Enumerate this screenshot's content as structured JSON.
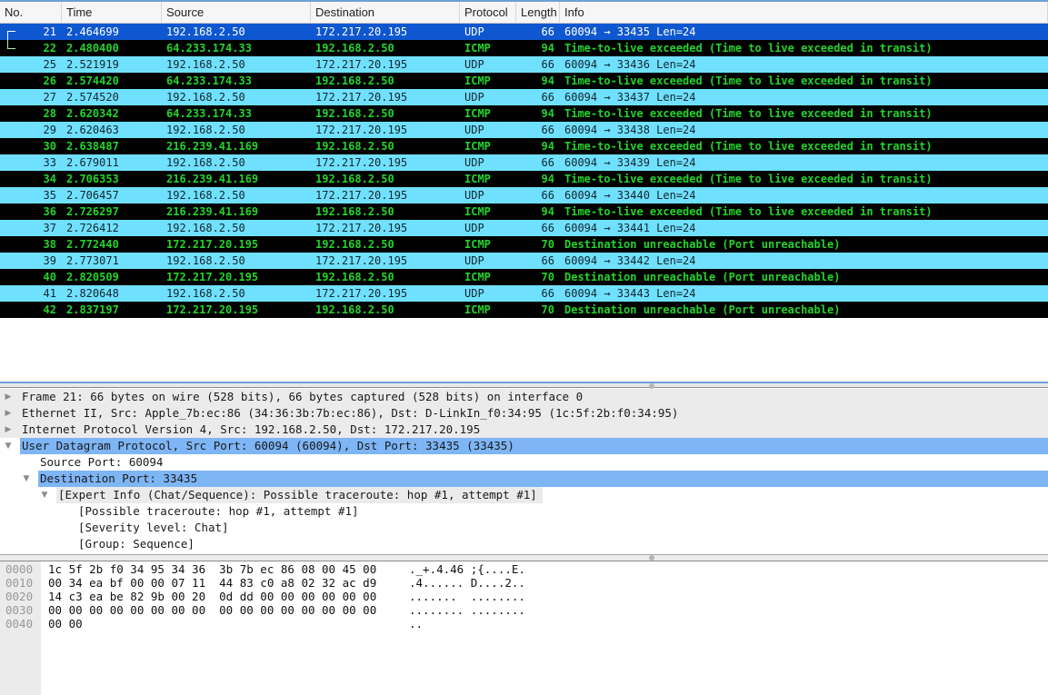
{
  "packet_list": {
    "columns": [
      "No.",
      "Time",
      "Source",
      "Destination",
      "Protocol",
      "Length",
      "Info"
    ],
    "rows": [
      {
        "no": "21",
        "time": "2.464699",
        "src": "192.168.2.50",
        "dst": "172.217.20.195",
        "proto": "UDP",
        "len": "66",
        "info": "60094 → 33435  Len=24",
        "type": "sel"
      },
      {
        "no": "22",
        "time": "2.480400",
        "src": "64.233.174.33",
        "dst": "192.168.2.50",
        "proto": "ICMP",
        "len": "94",
        "info": "Time-to-live exceeded (Time to live exceeded in transit)",
        "type": "icmp"
      },
      {
        "no": "25",
        "time": "2.521919",
        "src": "192.168.2.50",
        "dst": "172.217.20.195",
        "proto": "UDP",
        "len": "66",
        "info": "60094 → 33436  Len=24",
        "type": "udp"
      },
      {
        "no": "26",
        "time": "2.574420",
        "src": "64.233.174.33",
        "dst": "192.168.2.50",
        "proto": "ICMP",
        "len": "94",
        "info": "Time-to-live exceeded (Time to live exceeded in transit)",
        "type": "icmp"
      },
      {
        "no": "27",
        "time": "2.574520",
        "src": "192.168.2.50",
        "dst": "172.217.20.195",
        "proto": "UDP",
        "len": "66",
        "info": "60094 → 33437  Len=24",
        "type": "udp"
      },
      {
        "no": "28",
        "time": "2.620342",
        "src": "64.233.174.33",
        "dst": "192.168.2.50",
        "proto": "ICMP",
        "len": "94",
        "info": "Time-to-live exceeded (Time to live exceeded in transit)",
        "type": "icmp"
      },
      {
        "no": "29",
        "time": "2.620463",
        "src": "192.168.2.50",
        "dst": "172.217.20.195",
        "proto": "UDP",
        "len": "66",
        "info": "60094 → 33438  Len=24",
        "type": "udp"
      },
      {
        "no": "30",
        "time": "2.638487",
        "src": "216.239.41.169",
        "dst": "192.168.2.50",
        "proto": "ICMP",
        "len": "94",
        "info": "Time-to-live exceeded (Time to live exceeded in transit)",
        "type": "icmp"
      },
      {
        "no": "33",
        "time": "2.679011",
        "src": "192.168.2.50",
        "dst": "172.217.20.195",
        "proto": "UDP",
        "len": "66",
        "info": "60094 → 33439  Len=24",
        "type": "udp"
      },
      {
        "no": "34",
        "time": "2.706353",
        "src": "216.239.41.169",
        "dst": "192.168.2.50",
        "proto": "ICMP",
        "len": "94",
        "info": "Time-to-live exceeded (Time to live exceeded in transit)",
        "type": "icmp"
      },
      {
        "no": "35",
        "time": "2.706457",
        "src": "192.168.2.50",
        "dst": "172.217.20.195",
        "proto": "UDP",
        "len": "66",
        "info": "60094 → 33440  Len=24",
        "type": "udp"
      },
      {
        "no": "36",
        "time": "2.726297",
        "src": "216.239.41.169",
        "dst": "192.168.2.50",
        "proto": "ICMP",
        "len": "94",
        "info": "Time-to-live exceeded (Time to live exceeded in transit)",
        "type": "icmp"
      },
      {
        "no": "37",
        "time": "2.726412",
        "src": "192.168.2.50",
        "dst": "172.217.20.195",
        "proto": "UDP",
        "len": "66",
        "info": "60094 → 33441  Len=24",
        "type": "udp"
      },
      {
        "no": "38",
        "time": "2.772440",
        "src": "172.217.20.195",
        "dst": "192.168.2.50",
        "proto": "ICMP",
        "len": "70",
        "info": "Destination unreachable (Port unreachable)",
        "type": "icmp"
      },
      {
        "no": "39",
        "time": "2.773071",
        "src": "192.168.2.50",
        "dst": "172.217.20.195",
        "proto": "UDP",
        "len": "66",
        "info": "60094 → 33442  Len=24",
        "type": "udp"
      },
      {
        "no": "40",
        "time": "2.820509",
        "src": "172.217.20.195",
        "dst": "192.168.2.50",
        "proto": "ICMP",
        "len": "70",
        "info": "Destination unreachable (Port unreachable)",
        "type": "icmp"
      },
      {
        "no": "41",
        "time": "2.820648",
        "src": "192.168.2.50",
        "dst": "172.217.20.195",
        "proto": "UDP",
        "len": "66",
        "info": "60094 → 33443  Len=24",
        "type": "udp"
      },
      {
        "no": "42",
        "time": "2.837197",
        "src": "172.217.20.195",
        "dst": "192.168.2.50",
        "proto": "ICMP",
        "len": "70",
        "info": "Destination unreachable (Port unreachable)",
        "type": "icmp"
      }
    ],
    "colors": {
      "udp_bg": "#70e0ff",
      "icmp_bg": "#000000",
      "icmp_fg": "#23d42a",
      "selected_bg": "#0f57d0"
    }
  },
  "details": [
    {
      "text": "Frame 21: 66 bytes on wire (528 bits), 66 bytes captured (528 bits) on interface 0",
      "level": 0,
      "state": "collapsed"
    },
    {
      "text": "Ethernet II, Src: Apple_7b:ec:86 (34:36:3b:7b:ec:86), Dst: D-LinkIn_f0:34:95 (1c:5f:2b:f0:34:95)",
      "level": 0,
      "state": "collapsed"
    },
    {
      "text": "Internet Protocol Version 4, Src: 192.168.2.50, Dst: 172.217.20.195",
      "level": 0,
      "state": "collapsed"
    },
    {
      "text": "User Datagram Protocol, Src Port: 60094 (60094), Dst Port: 33435 (33435)",
      "level": 0,
      "state": "expanded"
    },
    {
      "text": "Source Port: 60094",
      "level": 1,
      "state": "leaf"
    },
    {
      "text": "Destination Port: 33435",
      "level": 1,
      "state": "expanded"
    },
    {
      "text": "[Expert Info (Chat/Sequence): Possible traceroute: hop #1, attempt #1]",
      "level": 2,
      "state": "expanded"
    },
    {
      "text": "[Possible traceroute: hop #1, attempt #1]",
      "level": 3,
      "state": "leaf"
    },
    {
      "text": "[Severity level: Chat]",
      "level": 3,
      "state": "leaf"
    },
    {
      "text": "[Group: Sequence]",
      "level": 3,
      "state": "leaf"
    }
  ],
  "bytes": [
    {
      "offset": "0000",
      "hex": "1c 5f 2b f0 34 95 34 36  3b 7b ec 86 08 00 45 00",
      "ascii": "._+.4.46 ;{....E."
    },
    {
      "offset": "0010",
      "hex": "00 34 ea bf 00 00 07 11  44 83 c0 a8 02 32 ac d9",
      "ascii": ".4...... D....2.."
    },
    {
      "offset": "0020",
      "hex": "14 c3 ea be 82 9b 00 20  0d dd 00 00 00 00 00 00",
      "ascii": ".......  ........"
    },
    {
      "offset": "0030",
      "hex": "00 00 00 00 00 00 00 00  00 00 00 00 00 00 00 00",
      "ascii": "........ ........"
    },
    {
      "offset": "0040",
      "hex": "00 00",
      "ascii": ".."
    }
  ]
}
